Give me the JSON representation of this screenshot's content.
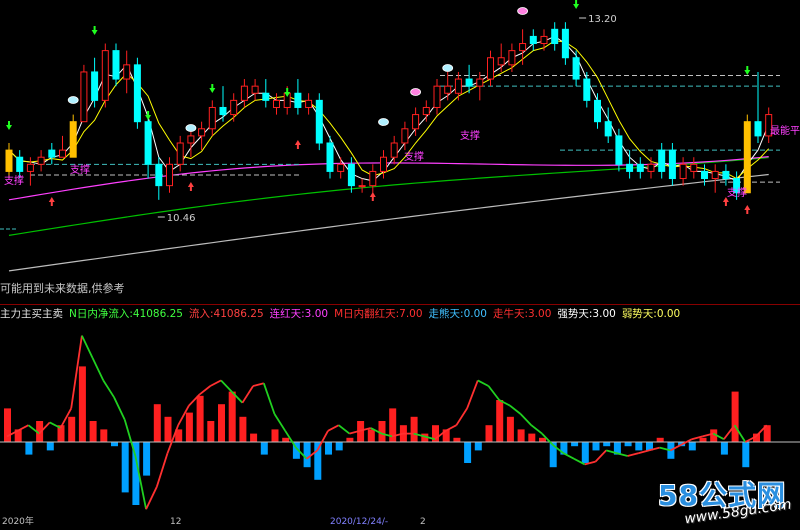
{
  "colors": {
    "bg": "#000000",
    "up_candle": "#ff2020",
    "down_candle": "#00ffff",
    "ma_white": "#ffffff",
    "ma_yellow": "#ffff00",
    "ma_magenta": "#ff40ff",
    "ma_green": "#00c000",
    "ma_gray": "#bdbdbd",
    "support_text": "#ff40ff",
    "dashed_cyan": "#40c0c0",
    "dashed_white": "#c0c0c0",
    "arrow_up": "#ff4040",
    "arrow_down": "#20ff20",
    "flow_up": "#ff2020",
    "flow_down": "#00a0ff",
    "flow_line_up": "#ff3030",
    "flow_line_down": "#20d020"
  },
  "upper": {
    "high_label": "13.20",
    "low_label": "10.46",
    "support_label": "支撑",
    "right_label": "最能平",
    "note": "可能用到未来数据,供参考",
    "icons": {
      "gem": "gem-icon",
      "pink": "lotus-icon",
      "up_arrow": "up-arrow-icon",
      "down_arrow": "down-arrow-icon"
    }
  },
  "lower": {
    "title": "主力主买主卖",
    "indicators": [
      {
        "text": "N日内净流入:41086.25",
        "color": "#40ff40"
      },
      {
        "text": "流入:41086.25",
        "color": "#ff4040"
      },
      {
        "text": "连红天:3.00",
        "color": "#ff40ff"
      },
      {
        "text": "M日内翻红天:7.00",
        "color": "#ff3030"
      },
      {
        "text": "走熊天:0.00",
        "color": "#40c0ff"
      },
      {
        "text": "走牛天:3.00",
        "color": "#ff3030"
      },
      {
        "text": "强势天:3.00",
        "color": "#ffffff"
      },
      {
        "text": "弱势天:0.00",
        "color": "#ffff60"
      }
    ],
    "watermark_main": "58公式网",
    "watermark_url": "www.58gu.com",
    "axis_labels": [
      "2020年",
      "12",
      "2020/12/24/-",
      "2"
    ]
  },
  "chart_data": [
    {
      "type": "candlestick",
      "title": "",
      "ohlc": [
        [
          11.1,
          11.5,
          11.0,
          11.4,
          "y"
        ],
        [
          11.3,
          11.4,
          11.0,
          11.1,
          "d"
        ],
        [
          11.1,
          11.3,
          10.9,
          11.2,
          "u"
        ],
        [
          11.2,
          11.4,
          11.1,
          11.3,
          "u"
        ],
        [
          11.3,
          11.5,
          11.2,
          11.4,
          "d"
        ],
        [
          11.4,
          11.6,
          11.3,
          11.3,
          "u"
        ],
        [
          11.3,
          11.9,
          11.3,
          11.8,
          "y"
        ],
        [
          11.8,
          12.6,
          11.8,
          12.5,
          "u"
        ],
        [
          12.5,
          12.7,
          12.0,
          12.1,
          "d"
        ],
        [
          12.1,
          12.9,
          12.0,
          12.8,
          "u"
        ],
        [
          12.8,
          12.9,
          12.3,
          12.4,
          "d"
        ],
        [
          12.4,
          12.8,
          12.2,
          12.6,
          "u"
        ],
        [
          12.6,
          12.7,
          11.7,
          11.8,
          "d"
        ],
        [
          11.8,
          11.9,
          11.0,
          11.2,
          "d"
        ],
        [
          11.2,
          11.3,
          10.7,
          10.9,
          "d"
        ],
        [
          10.9,
          11.3,
          10.8,
          11.2,
          "u"
        ],
        [
          11.2,
          11.6,
          11.1,
          11.5,
          "u"
        ],
        [
          11.5,
          11.7,
          11.3,
          11.6,
          "u"
        ],
        [
          11.6,
          11.8,
          11.4,
          11.7,
          "u"
        ],
        [
          11.7,
          12.1,
          11.6,
          12.0,
          "u"
        ],
        [
          12.0,
          12.3,
          11.8,
          11.9,
          "d"
        ],
        [
          11.9,
          12.2,
          11.8,
          12.1,
          "u"
        ],
        [
          12.1,
          12.4,
          12.0,
          12.3,
          "u"
        ],
        [
          12.3,
          12.4,
          12.1,
          12.2,
          "u"
        ],
        [
          12.2,
          12.4,
          12.0,
          12.1,
          "d"
        ],
        [
          12.1,
          12.2,
          11.9,
          12.0,
          "u"
        ],
        [
          12.0,
          12.3,
          11.9,
          12.2,
          "u"
        ],
        [
          12.2,
          12.4,
          11.9,
          12.0,
          "d"
        ],
        [
          12.0,
          12.2,
          11.9,
          12.1,
          "u"
        ],
        [
          12.1,
          12.2,
          11.4,
          11.5,
          "d"
        ],
        [
          11.5,
          11.6,
          11.0,
          11.1,
          "d"
        ],
        [
          11.1,
          11.3,
          11.0,
          11.2,
          "u"
        ],
        [
          11.2,
          11.3,
          10.8,
          10.9,
          "d"
        ],
        [
          10.9,
          11.0,
          10.8,
          10.9,
          "u"
        ],
        [
          10.9,
          11.2,
          10.8,
          11.1,
          "u"
        ],
        [
          11.1,
          11.4,
          11.0,
          11.3,
          "u"
        ],
        [
          11.3,
          11.6,
          11.2,
          11.5,
          "u"
        ],
        [
          11.5,
          11.8,
          11.4,
          11.7,
          "u"
        ],
        [
          11.7,
          12.0,
          11.6,
          11.9,
          "u"
        ],
        [
          11.9,
          12.1,
          11.8,
          12.0,
          "u"
        ],
        [
          12.0,
          12.4,
          11.9,
          12.3,
          "u"
        ],
        [
          12.3,
          12.5,
          12.1,
          12.2,
          "u"
        ],
        [
          12.2,
          12.5,
          12.1,
          12.4,
          "u"
        ],
        [
          12.4,
          12.6,
          12.2,
          12.3,
          "d"
        ],
        [
          12.3,
          12.5,
          12.1,
          12.4,
          "u"
        ],
        [
          12.4,
          12.8,
          12.3,
          12.7,
          "u"
        ],
        [
          12.7,
          12.9,
          12.5,
          12.6,
          "u"
        ],
        [
          12.6,
          12.9,
          12.5,
          12.8,
          "u"
        ],
        [
          12.8,
          13.1,
          12.6,
          12.9,
          "u"
        ],
        [
          12.9,
          13.1,
          12.8,
          13.0,
          "d"
        ],
        [
          13.0,
          13.1,
          12.8,
          12.9,
          "u"
        ],
        [
          12.9,
          13.2,
          12.8,
          13.1,
          "d"
        ],
        [
          13.1,
          13.2,
          12.6,
          12.7,
          "d"
        ],
        [
          12.7,
          12.8,
          12.3,
          12.4,
          "d"
        ],
        [
          12.4,
          12.5,
          12.0,
          12.1,
          "d"
        ],
        [
          12.1,
          12.2,
          11.7,
          11.8,
          "d"
        ],
        [
          11.8,
          12.0,
          11.5,
          11.6,
          "d"
        ],
        [
          11.6,
          11.7,
          11.1,
          11.2,
          "d"
        ],
        [
          11.2,
          11.4,
          11.0,
          11.1,
          "d"
        ],
        [
          11.1,
          11.3,
          11.0,
          11.2,
          "d"
        ],
        [
          11.2,
          11.3,
          11.0,
          11.1,
          "u"
        ],
        [
          11.1,
          11.5,
          11.0,
          11.4,
          "d"
        ],
        [
          11.4,
          11.5,
          10.9,
          11.0,
          "d"
        ],
        [
          11.0,
          11.3,
          10.9,
          11.2,
          "u"
        ],
        [
          11.2,
          11.3,
          11.0,
          11.1,
          "u"
        ],
        [
          11.1,
          11.2,
          10.9,
          11.0,
          "d"
        ],
        [
          11.0,
          11.2,
          10.8,
          11.1,
          "u"
        ],
        [
          11.1,
          11.2,
          10.9,
          11.0,
          "d"
        ],
        [
          11.0,
          11.1,
          10.7,
          10.8,
          "d"
        ],
        [
          10.8,
          11.9,
          10.8,
          11.8,
          "y"
        ],
        [
          11.8,
          12.5,
          11.5,
          11.6,
          "d"
        ],
        [
          11.6,
          12.0,
          11.5,
          11.9,
          "u"
        ]
      ]
    },
    {
      "type": "bar",
      "title": "主力主买主卖",
      "values": [
        0.8,
        0.3,
        -0.3,
        0.5,
        -0.2,
        0.4,
        0.6,
        1.8,
        0.5,
        0.3,
        -0.1,
        -1.2,
        -1.5,
        -0.8,
        0.9,
        0.6,
        0.3,
        0.7,
        1.1,
        0.5,
        0.9,
        1.2,
        0.6,
        0.2,
        -0.3,
        0.3,
        0.1,
        -0.4,
        -0.6,
        -0.9,
        -0.3,
        -0.2,
        0.1,
        0.5,
        0.3,
        0.5,
        0.8,
        0.4,
        0.6,
        0.2,
        0.4,
        0.3,
        0.1,
        -0.5,
        -0.2,
        0.4,
        1.0,
        0.6,
        0.3,
        0.2,
        0.1,
        -0.6,
        -0.3,
        -0.1,
        -0.5,
        -0.2,
        -0.1,
        -0.3,
        -0.1,
        -0.2,
        -0.2,
        0.1,
        -0.4,
        -0.1,
        -0.2,
        0.1,
        0.3,
        -0.3,
        1.2,
        -0.6,
        0.2,
        0.4
      ],
      "line": [
        0.2,
        0.4,
        0.6,
        0.3,
        0.7,
        0.5,
        1.2,
        3.8,
        3.0,
        2.2,
        1.6,
        0.8,
        -0.5,
        -2.4,
        -1.6,
        -0.4,
        0.6,
        1.3,
        1.7,
        2.0,
        2.2,
        1.8,
        1.4,
        2.0,
        2.1,
        1.0,
        0.4,
        -0.2,
        -0.6,
        -0.3,
        0.4,
        0.6,
        0.3,
        0.4,
        0.5,
        0.3,
        0.2,
        0.3,
        0.3,
        0.2,
        0.1,
        0.4,
        0.6,
        1.2,
        2.2,
        2.0,
        1.5,
        1.3,
        1.0,
        0.6,
        0.3,
        -0.1,
        -0.4,
        -0.6,
        -0.8,
        -0.7,
        -0.3,
        -0.4,
        -0.5,
        -0.4,
        -0.3,
        -0.2,
        -0.3,
        -0.1,
        0.1,
        0.2,
        0.3,
        0.1,
        0.6,
        0.0,
        0.2,
        0.6
      ]
    }
  ]
}
